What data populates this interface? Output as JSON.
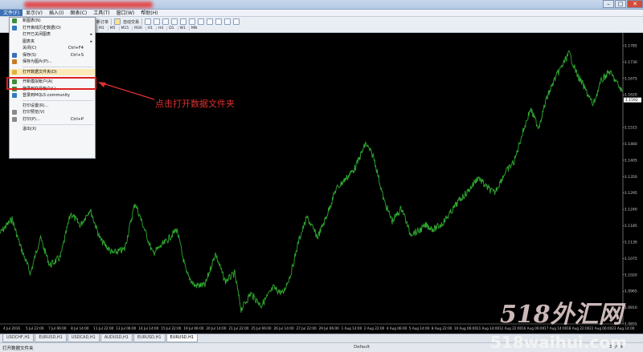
{
  "menubar": {
    "items": [
      "文件(F)",
      "显示(V)",
      "插入(I)",
      "图表(C)",
      "工具(T)",
      "窗口(W)",
      "帮助(H)"
    ],
    "active_index": 0
  },
  "toolbar": {
    "new_order": "新订单",
    "auto_trade": "自动交易",
    "timeframes": [
      "M1",
      "M5",
      "M15",
      "M30",
      "H1",
      "H4",
      "D1",
      "W1",
      "MN"
    ]
  },
  "file_menu": {
    "items": [
      {
        "label": "新图表(N)",
        "shortcut": "",
        "arrow": false,
        "icon_color": "#3c8f3c"
      },
      {
        "label": "打开离线历史数据(O)",
        "shortcut": "",
        "arrow": false,
        "icon_color": "#2e7bc4"
      },
      {
        "label": "打开已关闭图表",
        "shortcut": "",
        "arrow": true,
        "icon_color": ""
      },
      {
        "label": "图表夹",
        "shortcut": "",
        "arrow": true,
        "icon_color": ""
      },
      {
        "label": "关闭(C)",
        "shortcut": "Ctrl+F4",
        "arrow": false,
        "icon_color": ""
      },
      {
        "label": "保存(S)",
        "shortcut": "Ctrl+S",
        "arrow": false,
        "icon_color": "#3a6fb6"
      },
      {
        "label": "保存为图片(P)...",
        "shortcut": "",
        "arrow": false,
        "icon_color": "#c77b25"
      },
      {
        "sep": true
      },
      {
        "label": "打开数据文件夹(D)",
        "shortcut": "",
        "arrow": false,
        "icon_color": "#e0b33a",
        "highlighted": true
      },
      {
        "sep": true
      },
      {
        "label": "开新模拟帐户(A)",
        "shortcut": "",
        "arrow": false,
        "icon_color": "#3c8f3c"
      },
      {
        "label": "登录到交易帐户(L)",
        "shortcut": "",
        "arrow": false,
        "icon_color": "#3c8f3c"
      },
      {
        "label": "登录到MQL5.community",
        "shortcut": "",
        "arrow": false,
        "icon_color": "#2e7bc4"
      },
      {
        "sep": true
      },
      {
        "label": "打印设置(R)...",
        "shortcut": "",
        "arrow": false,
        "icon_color": ""
      },
      {
        "label": "打印预览(V)",
        "shortcut": "",
        "arrow": false,
        "icon_color": "#8a8a8a"
      },
      {
        "label": "打印(P)...",
        "shortcut": "Ctrl+P",
        "arrow": false,
        "icon_color": "#8a8a8a"
      },
      {
        "sep": true
      },
      {
        "label": "退出(X)",
        "shortcut": "",
        "arrow": false,
        "icon_color": ""
      }
    ]
  },
  "annotation": {
    "text": "点击打开数据文件夹",
    "color": "#e03030"
  },
  "chart": {
    "symbol": "EURUSD,H1",
    "current_price": "1.1592",
    "price_labels": [
      "1.1785",
      "1.1730",
      "1.1675",
      "1.1620",
      "1.1592",
      "1.1515",
      "1.1460",
      "1.1405",
      "1.1350",
      "1.1295",
      "1.1240",
      "1.1185",
      "1.1130",
      "1.1075",
      "1.1020",
      "1.0965",
      "1.0910",
      "1.0855"
    ],
    "time_labels": [
      "4 Jul 2016",
      "5 Jul 22:00",
      "7 Jul 06:00",
      "8 Jul 14:00",
      "11 Jul 22:00",
      "13 Jul 06:00",
      "14 Jul 14:00",
      "15 Jul 22:00",
      "19 Jul 06:00",
      "20 Jul 14:00",
      "21 Jul 22:00",
      "25 Jul 06:00",
      "26 Jul 14:00",
      "27 Jul 22:00",
      "29 Jul 06:00",
      "1 Aug 14:00",
      "2 Aug 22:00",
      "4 Aug 06:00",
      "5 Aug 14:00",
      "8 Aug 22:00",
      "10 Aug 06:00",
      "11 Aug 14:00",
      "12 Aug 22:00",
      "16 Aug 06:00",
      "17 Aug 14:00",
      "18 Aug 22:00",
      "22 Aug 06:00",
      "23 Aug 14:00"
    ],
    "line_color": "#2fa82f"
  },
  "tabs": [
    {
      "label": "USDCHF,H1",
      "active": false
    },
    {
      "label": "EURUSD,H1",
      "active": false
    },
    {
      "label": "USDCAD,H1",
      "active": false
    },
    {
      "label": "AUDUSD,H1",
      "active": false
    },
    {
      "label": "EURUSD,H1",
      "active": false
    },
    {
      "label": "EURUSD,H1",
      "active": true
    }
  ],
  "status": {
    "left": "打开数据文件夹",
    "profile": "Default",
    "connection": "35/0 kb"
  },
  "watermark": {
    "line1": "518外汇网",
    "line2": "518waihui.com"
  }
}
